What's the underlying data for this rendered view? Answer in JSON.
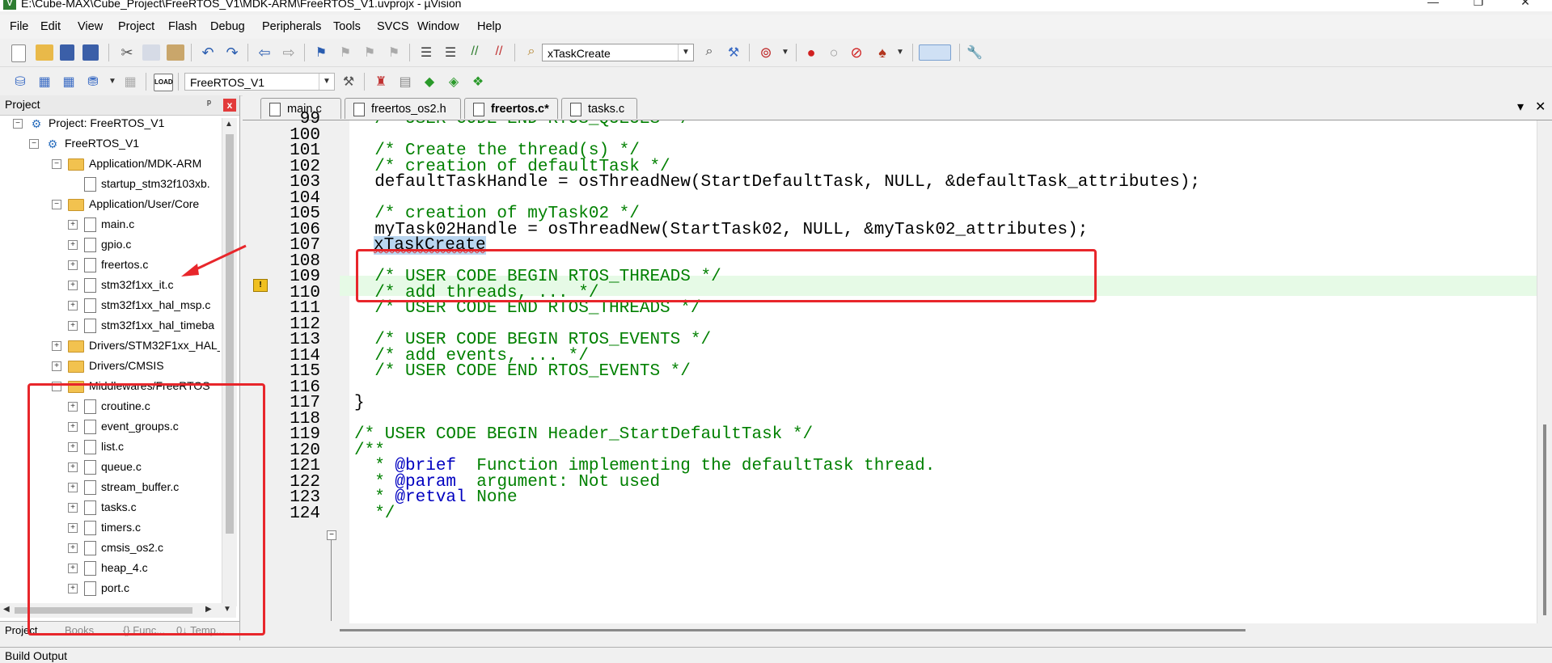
{
  "window": {
    "title": "E:\\Cube-MAX\\Cube_Project\\FreeRTOS_V1\\MDK-ARM\\FreeRTOS_V1.uvprojx - µVision",
    "min_glyph": "—",
    "max_glyph": "❐",
    "close_glyph": "✕"
  },
  "menu": [
    "File",
    "Edit",
    "View",
    "Project",
    "Flash",
    "Debug",
    "Peripherals",
    "Tools",
    "SVCS",
    "Window",
    "Help"
  ],
  "toolbar": {
    "find_combo_value": "xTaskCreate",
    "target_combo_value": "FreeRTOS_V1"
  },
  "project_panel": {
    "title": "Project",
    "pin_glyph": "ᵖ",
    "close_glyph": "x",
    "tree": [
      {
        "label": "Project: FreeRTOS_V1",
        "kind": "project",
        "exp": "⊟"
      },
      {
        "label": "FreeRTOS_V1",
        "kind": "target",
        "exp": "⊟"
      },
      {
        "label": "Application/MDK-ARM",
        "kind": "folder",
        "exp": "⊟"
      },
      {
        "label": "startup_stm32f103xb.",
        "kind": "file",
        "exp": ""
      },
      {
        "label": "Application/User/Core",
        "kind": "folder",
        "exp": "⊟"
      },
      {
        "label": "main.c",
        "kind": "file",
        "exp": "⊞"
      },
      {
        "label": "gpio.c",
        "kind": "file",
        "exp": "⊞"
      },
      {
        "label": "freertos.c",
        "kind": "file",
        "exp": "⊞"
      },
      {
        "label": "stm32f1xx_it.c",
        "kind": "file",
        "exp": "⊞"
      },
      {
        "label": "stm32f1xx_hal_msp.c",
        "kind": "file",
        "exp": "⊞"
      },
      {
        "label": "stm32f1xx_hal_timeba",
        "kind": "file",
        "exp": "⊞"
      },
      {
        "label": "Drivers/STM32F1xx_HAL_",
        "kind": "folder",
        "exp": "⊞"
      },
      {
        "label": "Drivers/CMSIS",
        "kind": "folder",
        "exp": "⊞"
      },
      {
        "label": "Middlewares/FreeRTOS",
        "kind": "folder",
        "exp": "⊟"
      },
      {
        "label": "croutine.c",
        "kind": "file",
        "exp": "⊞"
      },
      {
        "label": "event_groups.c",
        "kind": "file",
        "exp": "⊞"
      },
      {
        "label": "list.c",
        "kind": "file",
        "exp": "⊞"
      },
      {
        "label": "queue.c",
        "kind": "file",
        "exp": "⊞"
      },
      {
        "label": "stream_buffer.c",
        "kind": "file",
        "exp": "⊞"
      },
      {
        "label": "tasks.c",
        "kind": "file",
        "exp": "⊞"
      },
      {
        "label": "timers.c",
        "kind": "file",
        "exp": "⊞"
      },
      {
        "label": "cmsis_os2.c",
        "kind": "file",
        "exp": "⊞"
      },
      {
        "label": "heap_4.c",
        "kind": "file",
        "exp": "⊞"
      },
      {
        "label": "port.c",
        "kind": "file",
        "exp": "⊞"
      }
    ],
    "bottom_tabs": [
      "Project",
      "Books",
      "{} Func...",
      "0↓ Temp..."
    ]
  },
  "editor": {
    "tabs": [
      {
        "label": "main.c",
        "color": "#dfe8f6"
      },
      {
        "label": "freertos_os2.h",
        "color": "#fbf3b0"
      },
      {
        "label": "freertos.c*",
        "color": "#fbf3b0"
      },
      {
        "label": "tasks.c",
        "color": "#f6c9cf"
      }
    ],
    "tabbar_dropdown": "▾",
    "tabbar_close": "✕",
    "lines": [
      {
        "n": "99",
        "text": "  /* USER CODE END RTOS_QUEUES */",
        "type": "comment"
      },
      {
        "n": "100",
        "text": "",
        "type": "code"
      },
      {
        "n": "101",
        "text": "  /* Create the thread(s) */",
        "type": "comment"
      },
      {
        "n": "102",
        "text": "  /* creation of defaultTask */",
        "type": "comment"
      },
      {
        "n": "103",
        "text": "  defaultTaskHandle = osThreadNew(StartDefaultTask, NULL, &defaultTask_attributes);",
        "type": "code"
      },
      {
        "n": "104",
        "text": "",
        "type": "code"
      },
      {
        "n": "105",
        "text": "  /* creation of myTask02 */",
        "type": "comment"
      },
      {
        "n": "106",
        "text": "  myTask02Handle = osThreadNew(StartTask02, NULL, &myTask02_attributes);",
        "type": "code"
      },
      {
        "n": "107",
        "text": "xTaskCreate",
        "type": "selected"
      },
      {
        "n": "108",
        "text": "",
        "type": "code"
      },
      {
        "n": "109",
        "text": "  /* USER CODE BEGIN RTOS_THREADS */",
        "type": "comment"
      },
      {
        "n": "110",
        "text": "  /* add threads, ... */",
        "type": "comment"
      },
      {
        "n": "111",
        "text": "  /* USER CODE END RTOS_THREADS */",
        "type": "comment"
      },
      {
        "n": "112",
        "text": "",
        "type": "code"
      },
      {
        "n": "113",
        "text": "  /* USER CODE BEGIN RTOS_EVENTS */",
        "type": "comment"
      },
      {
        "n": "114",
        "text": "  /* add events, ... */",
        "type": "comment"
      },
      {
        "n": "115",
        "text": "  /* USER CODE END RTOS_EVENTS */",
        "type": "comment"
      },
      {
        "n": "116",
        "text": "",
        "type": "code"
      },
      {
        "n": "117",
        "text": "}",
        "type": "code"
      },
      {
        "n": "118",
        "text": "",
        "type": "code"
      },
      {
        "n": "119",
        "text": "/* USER CODE BEGIN Header_StartDefaultTask */",
        "type": "comment"
      },
      {
        "n": "120",
        "text": "/**",
        "type": "comment"
      },
      {
        "n": "121",
        "text": "  * @brief  Function implementing the defaultTask thread.",
        "type": "doc"
      },
      {
        "n": "122",
        "text": "  * @param  argument: Not used",
        "type": "doc"
      },
      {
        "n": "123",
        "text": "  * @retval None",
        "type": "doc"
      },
      {
        "n": "124",
        "text": "  */",
        "type": "comment"
      }
    ]
  },
  "build_output": {
    "title": "Build Output"
  },
  "colors": {
    "annotation_red": "#e8262b",
    "comment_green": "#008000",
    "doc_tag_blue": "#0000c0",
    "current_line": "#e6fae6"
  }
}
